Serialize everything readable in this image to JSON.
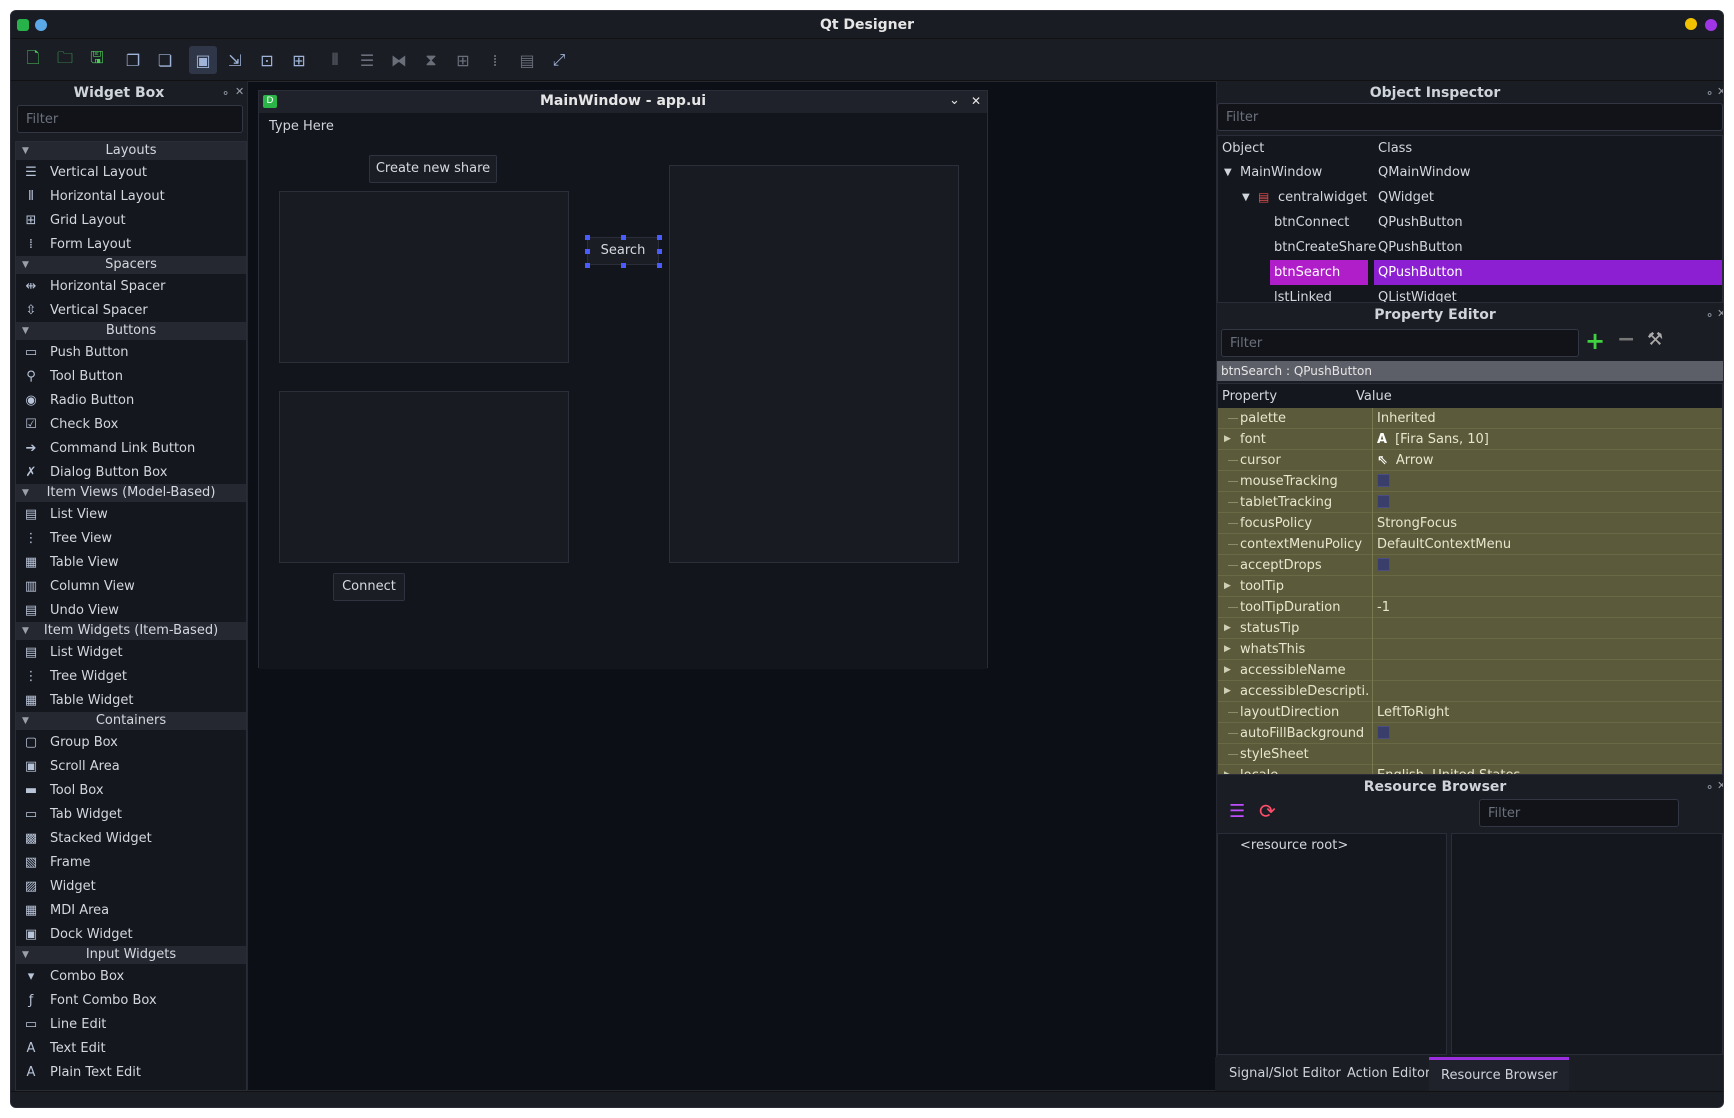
{
  "window": {
    "title": "Qt Designer"
  },
  "toolbar": {
    "buttons": [
      "new-file-icon",
      "open-folder-icon",
      "save-icon",
      "send-to-back-icon",
      "bring-to-front-icon",
      "edit-widgets-icon",
      "edit-signals-slots-icon",
      "edit-buddies-icon",
      "edit-tab-order-icon",
      "layout-horizontal-icon",
      "layout-vertical-icon",
      "layout-horizontal-splitter-icon",
      "layout-vertical-splitter-icon",
      "layout-grid-icon",
      "layout-form-icon",
      "break-layout-icon",
      "adjust-size-icon"
    ]
  },
  "widget_box": {
    "title": "Widget Box",
    "filter_placeholder": "Filter",
    "categories": [
      {
        "name": "Layouts",
        "items": [
          {
            "label": "Vertical Layout",
            "icon": "vertical-layout-icon"
          },
          {
            "label": "Horizontal Layout",
            "icon": "horizontal-layout-icon"
          },
          {
            "label": "Grid Layout",
            "icon": "grid-layout-icon"
          },
          {
            "label": "Form Layout",
            "icon": "form-layout-icon"
          }
        ]
      },
      {
        "name": "Spacers",
        "items": [
          {
            "label": "Horizontal Spacer",
            "icon": "horizontal-spacer-icon"
          },
          {
            "label": "Vertical Spacer",
            "icon": "vertical-spacer-icon"
          }
        ]
      },
      {
        "name": "Buttons",
        "items": [
          {
            "label": "Push Button",
            "icon": "push-button-icon"
          },
          {
            "label": "Tool Button",
            "icon": "tool-button-icon"
          },
          {
            "label": "Radio Button",
            "icon": "radio-button-icon"
          },
          {
            "label": "Check Box",
            "icon": "check-box-icon"
          },
          {
            "label": "Command Link Button",
            "icon": "command-link-icon"
          },
          {
            "label": "Dialog Button Box",
            "icon": "dialog-button-box-icon"
          }
        ]
      },
      {
        "name": "Item Views (Model-Based)",
        "items": [
          {
            "label": "List View",
            "icon": "list-view-icon"
          },
          {
            "label": "Tree View",
            "icon": "tree-view-icon"
          },
          {
            "label": "Table View",
            "icon": "table-view-icon"
          },
          {
            "label": "Column View",
            "icon": "column-view-icon"
          },
          {
            "label": "Undo View",
            "icon": "undo-view-icon"
          }
        ]
      },
      {
        "name": "Item Widgets (Item-Based)",
        "items": [
          {
            "label": "List Widget",
            "icon": "list-widget-icon"
          },
          {
            "label": "Tree Widget",
            "icon": "tree-widget-icon"
          },
          {
            "label": "Table Widget",
            "icon": "table-widget-icon"
          }
        ]
      },
      {
        "name": "Containers",
        "items": [
          {
            "label": "Group Box",
            "icon": "group-box-icon"
          },
          {
            "label": "Scroll Area",
            "icon": "scroll-area-icon"
          },
          {
            "label": "Tool Box",
            "icon": "tool-box-icon"
          },
          {
            "label": "Tab Widget",
            "icon": "tab-widget-icon"
          },
          {
            "label": "Stacked Widget",
            "icon": "stacked-widget-icon"
          },
          {
            "label": "Frame",
            "icon": "frame-icon"
          },
          {
            "label": "Widget",
            "icon": "widget-icon"
          },
          {
            "label": "MDI Area",
            "icon": "mdi-area-icon"
          },
          {
            "label": "Dock Widget",
            "icon": "dock-widget-icon"
          }
        ]
      },
      {
        "name": "Input Widgets",
        "items": [
          {
            "label": "Combo Box",
            "icon": "combo-box-icon"
          },
          {
            "label": "Font Combo Box",
            "icon": "font-combo-box-icon"
          },
          {
            "label": "Line Edit",
            "icon": "line-edit-icon"
          },
          {
            "label": "Text Edit",
            "icon": "text-edit-icon"
          },
          {
            "label": "Plain Text Edit",
            "icon": "plain-text-edit-icon"
          }
        ]
      }
    ]
  },
  "form": {
    "title": "MainWindow - app.ui",
    "menu_placeholder": "Type Here",
    "btn_create_share": "Create new share",
    "btn_search": "Search",
    "btn_connect": "Connect"
  },
  "object_inspector": {
    "title": "Object Inspector",
    "filter_placeholder": "Filter",
    "col_object": "Object",
    "col_class": "Class",
    "rows": [
      {
        "object": "MainWindow",
        "class": "QMainWindow",
        "level": 0,
        "expanded": true
      },
      {
        "object": "centralwidget",
        "class": "QWidget",
        "level": 1,
        "expanded": true
      },
      {
        "object": "btnConnect",
        "class": "QPushButton",
        "level": 2
      },
      {
        "object": "btnCreateShare",
        "class": "QPushButton",
        "level": 2
      },
      {
        "object": "btnSearch",
        "class": "QPushButton",
        "level": 2,
        "selected": true
      },
      {
        "object": "lstLinked",
        "class": "QListWidget",
        "level": 2
      }
    ]
  },
  "property_editor": {
    "title": "Property Editor",
    "filter_placeholder": "Filter",
    "context": "btnSearch : QPushButton",
    "col_property": "Property",
    "col_value": "Value",
    "rows": [
      {
        "name": "palette",
        "value": "Inherited"
      },
      {
        "name": "font",
        "value": "[Fira Sans, 10]",
        "expandable": true,
        "icon": "font-a-icon"
      },
      {
        "name": "cursor",
        "value": "Arrow",
        "icon": "arrow-cursor-icon"
      },
      {
        "name": "mouseTracking",
        "value": "",
        "checkbox": true
      },
      {
        "name": "tabletTracking",
        "value": "",
        "checkbox": true
      },
      {
        "name": "focusPolicy",
        "value": "StrongFocus"
      },
      {
        "name": "contextMenuPolicy",
        "value": "DefaultContextMenu"
      },
      {
        "name": "acceptDrops",
        "value": "",
        "checkbox": true
      },
      {
        "name": "toolTip",
        "value": "",
        "expandable": true
      },
      {
        "name": "toolTipDuration",
        "value": "-1"
      },
      {
        "name": "statusTip",
        "value": "",
        "expandable": true
      },
      {
        "name": "whatsThis",
        "value": "",
        "expandable": true
      },
      {
        "name": "accessibleName",
        "value": "",
        "expandable": true
      },
      {
        "name": "accessibleDescripti...",
        "value": "",
        "expandable": true
      },
      {
        "name": "layoutDirection",
        "value": "LeftToRight"
      },
      {
        "name": "autoFillBackground",
        "value": "",
        "checkbox": true
      },
      {
        "name": "styleSheet",
        "value": ""
      },
      {
        "name": "locale",
        "value": "English, United States",
        "expandable": true
      }
    ]
  },
  "resource_browser": {
    "title": "Resource Browser",
    "filter_placeholder": "Filter",
    "root": "<resource root>"
  },
  "bottom_tabs": [
    {
      "label": "Signal/Slot Editor",
      "active": false
    },
    {
      "label": "Action Editor",
      "active": false
    },
    {
      "label": "Resource Browser",
      "active": true
    }
  ],
  "colors": {
    "selection_object": "#b01ec9",
    "selection_class": "#8b1fd1",
    "property_row_bg": "#5b5a3a",
    "accent_tab": "#9b2fe0"
  }
}
